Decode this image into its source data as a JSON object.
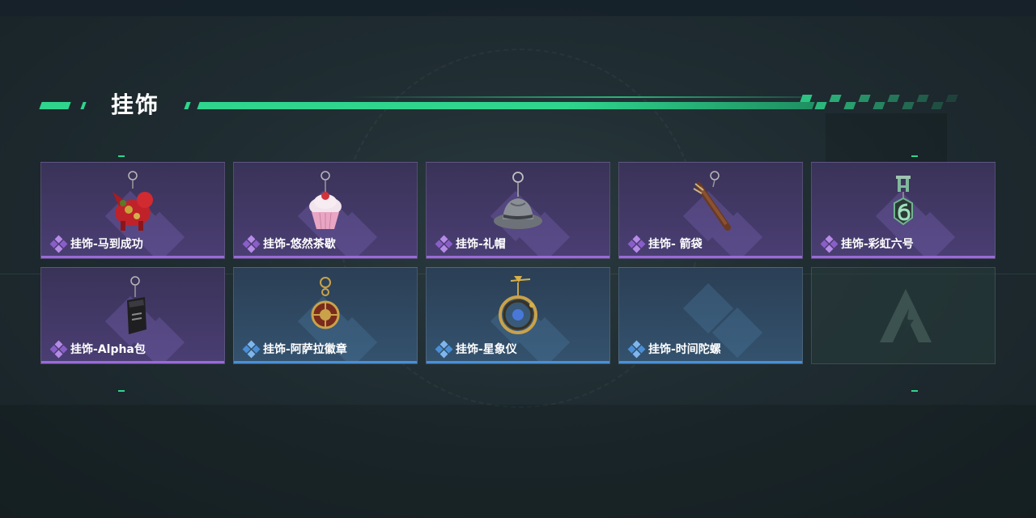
{
  "header": {
    "title": "挂饰"
  },
  "colors": {
    "accent": "#2fd58d",
    "rarity_purple": "#9a6ad8",
    "rarity_blue": "#4a8fd6",
    "card_purple": "#4a3e73",
    "card_blue": "#34526e"
  },
  "items": [
    {
      "name": "挂饰-马到成功",
      "rarity": "purple",
      "icon": "red-horse-charm-icon"
    },
    {
      "name": "挂饰-悠然茶歇",
      "rarity": "purple",
      "icon": "cupcake-charm-icon"
    },
    {
      "name": "挂饰-礼帽",
      "rarity": "purple",
      "icon": "hat-charm-icon"
    },
    {
      "name": "挂饰- 箭袋",
      "rarity": "purple",
      "icon": "quiver-charm-icon"
    },
    {
      "name": "挂饰-彩虹六号",
      "rarity": "purple",
      "icon": "rainbow-six-charm-icon"
    },
    {
      "name": "挂饰-Alpha包",
      "rarity": "purple",
      "icon": "alpha-pack-charm-icon"
    },
    {
      "name": "挂饰-阿萨拉徽章",
      "rarity": "blue",
      "icon": "asala-badge-charm-icon"
    },
    {
      "name": "挂饰-星象仪",
      "rarity": "blue",
      "icon": "astrolabe-charm-icon"
    },
    {
      "name": "挂饰-时间陀螺",
      "rarity": "blue",
      "icon": "time-top-charm-icon"
    },
    {
      "name": "",
      "rarity": "empty",
      "icon": "game-logo-icon"
    }
  ]
}
